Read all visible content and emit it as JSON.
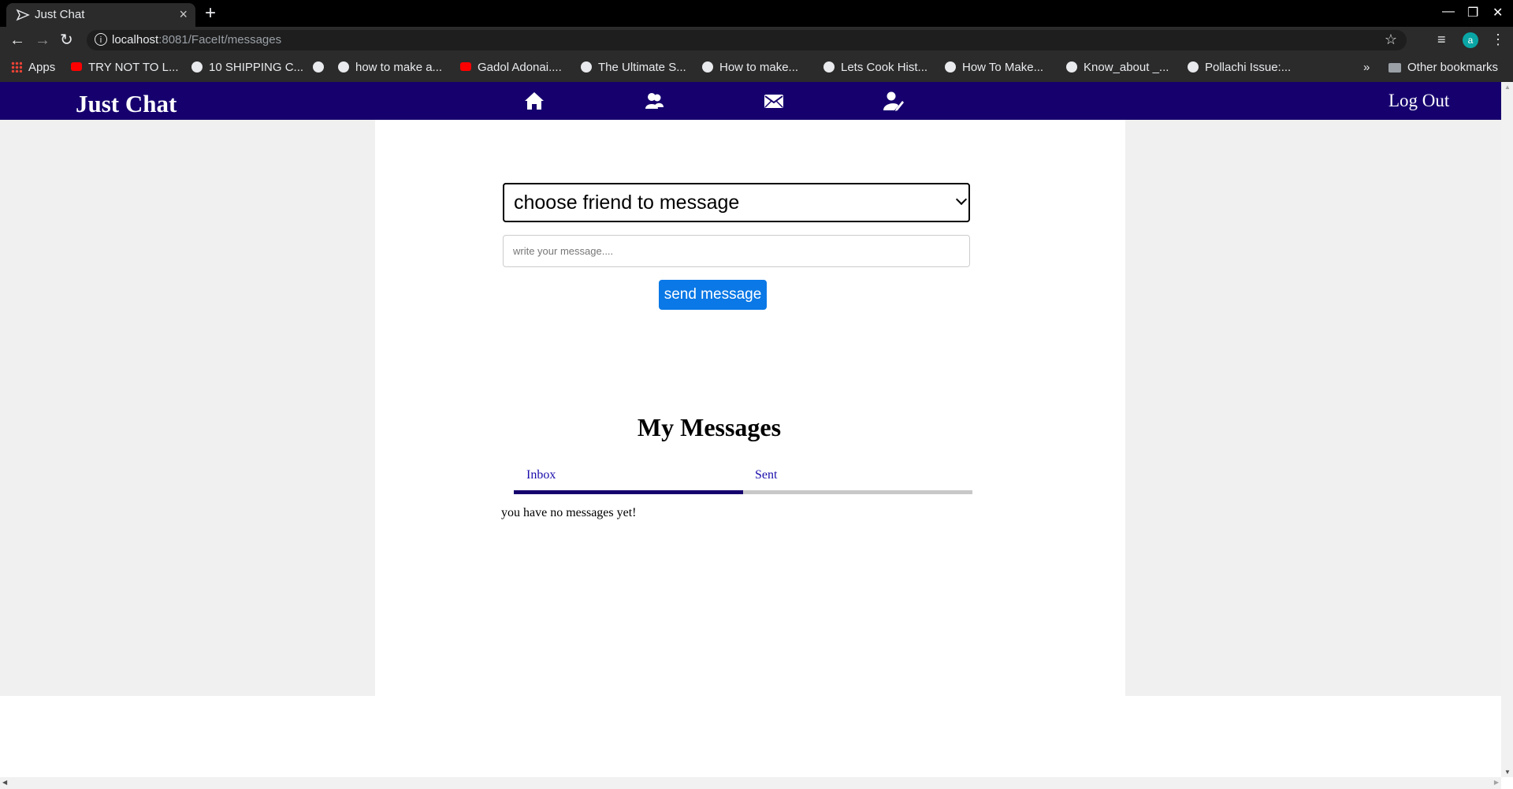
{
  "browser": {
    "tab_title": "Just Chat",
    "new_tab": "+",
    "url_host": "localhost",
    "url_rest": ":8081/FaceIt/messages",
    "profile_initial": "a",
    "bookmarks": [
      {
        "label": "Apps",
        "icon": "apps-grid-icon"
      },
      {
        "label": "TRY NOT TO L...",
        "icon": "youtube-icon"
      },
      {
        "label": "10 SHIPPING C...",
        "icon": "globe-icon"
      },
      {
        "label": "",
        "icon": "globe-icon"
      },
      {
        "label": "how to make a...",
        "icon": "globe-icon"
      },
      {
        "label": "Gadol Adonai....",
        "icon": "youtube-icon"
      },
      {
        "label": "The Ultimate S...",
        "icon": "globe-icon"
      },
      {
        "label": "How to make...",
        "icon": "globe-icon"
      },
      {
        "label": "Lets Cook Hist...",
        "icon": "globe-icon"
      },
      {
        "label": "How To Make...",
        "icon": "globe-icon"
      },
      {
        "label": "Know_about _...",
        "icon": "globe-icon"
      },
      {
        "label": "Pollachi Issue:...",
        "icon": "globe-icon"
      }
    ],
    "overflow": "»",
    "other_bookmarks": "Other bookmarks"
  },
  "app": {
    "brand": "Just Chat",
    "nav_icons": [
      "home-icon",
      "friends-icon",
      "messages-icon",
      "edit-profile-icon"
    ],
    "logout": "Log Out",
    "friend_select": "choose friend to message",
    "message_placeholder": "write your message....",
    "send_label": "send message",
    "heading": "My Messages",
    "tabs": {
      "inbox": "Inbox",
      "sent": "Sent",
      "active": "Inbox"
    },
    "empty_note": "you have no messages yet!"
  },
  "colors": {
    "appbar": "#16006e",
    "send_button": "#0a78e6",
    "link": "#1a0dab",
    "page_bg": "#f0f0f0"
  }
}
